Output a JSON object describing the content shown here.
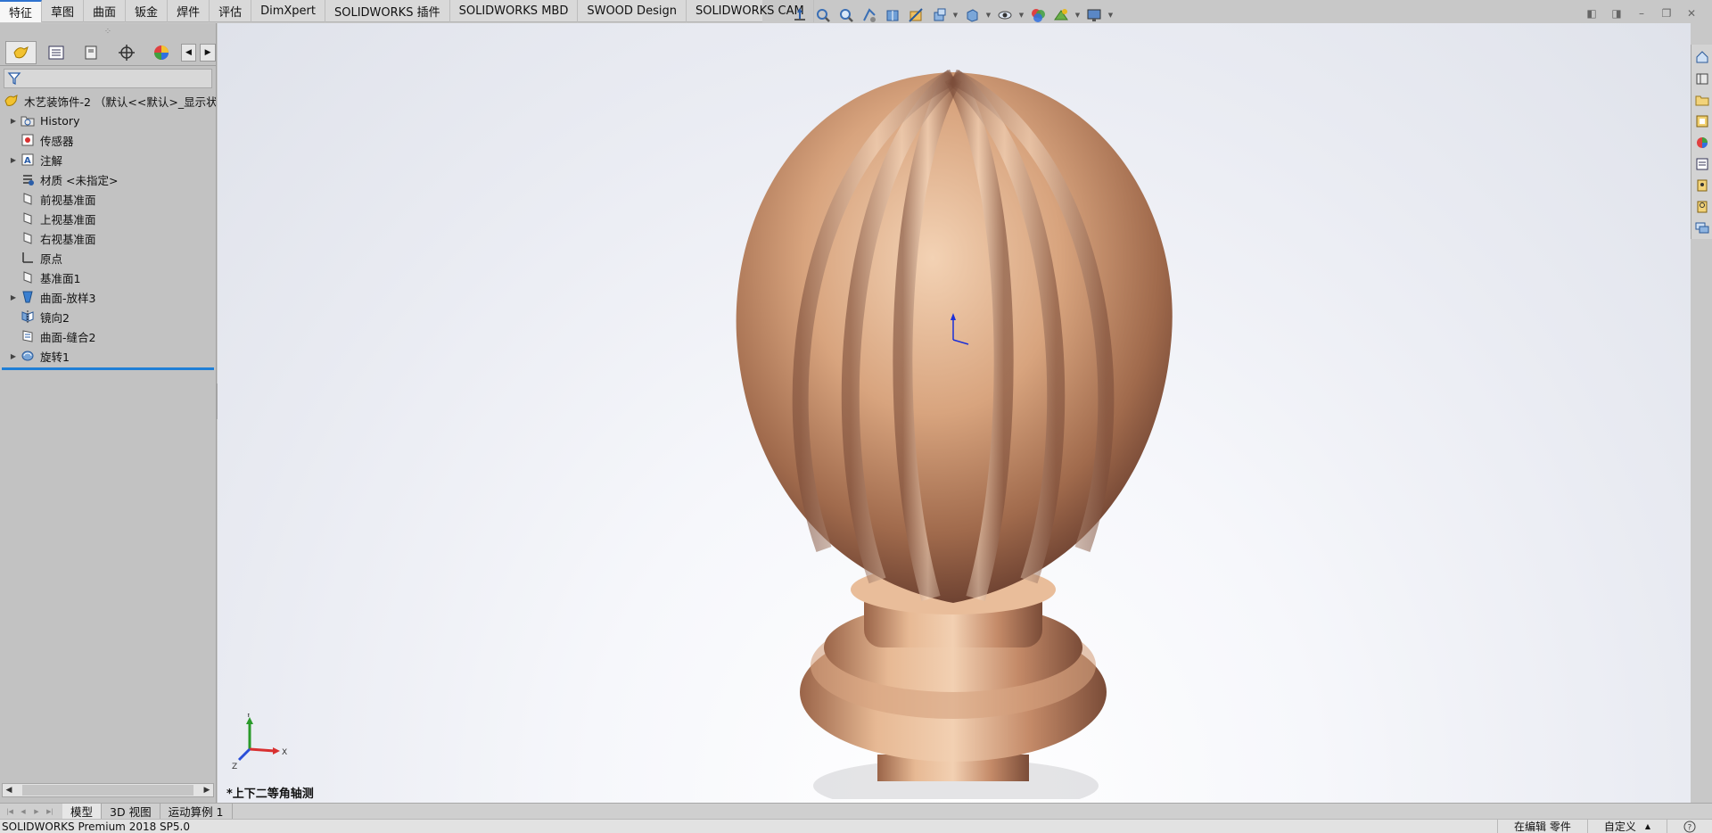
{
  "command_manager": {
    "tabs": [
      {
        "label": "特征",
        "active": true
      },
      {
        "label": "草图"
      },
      {
        "label": "曲面"
      },
      {
        "label": "钣金"
      },
      {
        "label": "焊件"
      },
      {
        "label": "评估"
      },
      {
        "label": "DimXpert"
      },
      {
        "label": "SOLIDWORKS 插件"
      },
      {
        "label": "SOLIDWORKS MBD"
      },
      {
        "label": "SWOOD Design"
      },
      {
        "label": "SOLIDWORKS CAM"
      }
    ]
  },
  "heads_up_toolbar": {
    "icons": [
      "view-orientation-icon",
      "zoom-to-fit-icon",
      "zoom-to-area-icon",
      "previous-view-icon",
      "section-view-icon",
      "dynamic-annotation-icon",
      "view-setting-icon",
      "display-style-icon",
      "hide-show-icon",
      "edit-appearance-icon",
      "apply-scene-icon",
      "view-settings-monitor-icon"
    ]
  },
  "feature_manager": {
    "panel_tabs": [
      "featuremanager-tab",
      "propertymanager-tab",
      "configurationmanager-tab",
      "dimxpertmanager-tab",
      "displaymanager-tab"
    ],
    "root_label": "木艺装饰件-2 （默认<<默认>_显示状态",
    "items": [
      {
        "label": "History",
        "icon": "history-folder-icon",
        "expandable": true
      },
      {
        "label": "传感器",
        "icon": "sensor-icon",
        "expandable": false
      },
      {
        "label": "注解",
        "icon": "annotation-icon",
        "expandable": true
      },
      {
        "label": "材质 <未指定>",
        "icon": "material-icon",
        "expandable": false
      },
      {
        "label": "前视基准面",
        "icon": "plane-icon",
        "expandable": false
      },
      {
        "label": "上视基准面",
        "icon": "plane-icon",
        "expandable": false
      },
      {
        "label": "右视基准面",
        "icon": "plane-icon",
        "expandable": false
      },
      {
        "label": "原点",
        "icon": "origin-icon",
        "expandable": false
      },
      {
        "label": "基准面1",
        "icon": "plane-icon",
        "expandable": false
      },
      {
        "label": "曲面-放样3",
        "icon": "surface-loft-icon",
        "expandable": true
      },
      {
        "label": "镜向2",
        "icon": "mirror-icon",
        "expandable": false
      },
      {
        "label": "曲面-缝合2",
        "icon": "knit-surface-icon",
        "expandable": false
      },
      {
        "label": "旋转1",
        "icon": "revolve-icon",
        "expandable": true
      }
    ]
  },
  "viewport": {
    "view_name": "*上下二等角轴测",
    "triad": {
      "x": "X",
      "y": "Y",
      "z": "Z"
    }
  },
  "bottom_tabs": [
    {
      "label": "模型",
      "active": true
    },
    {
      "label": "3D 视图"
    },
    {
      "label": "运动算例 1"
    }
  ],
  "status_bar": {
    "product": "SOLIDWORKS Premium 2018 SP5.0",
    "editing": "在编辑 零件",
    "units": "自定义"
  },
  "colors": {
    "accent_blue": "#1f7fd6",
    "wood_light": "#e8b48c",
    "wood_dark": "#8a5a40"
  }
}
